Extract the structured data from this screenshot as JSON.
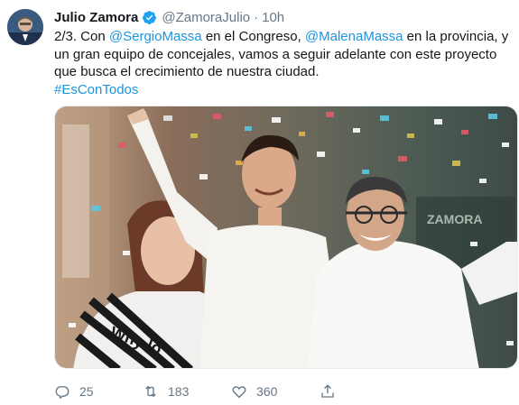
{
  "tweet": {
    "author_name": "Julio Zamora",
    "author_handle": "@ZamoraJulio",
    "separator": "·",
    "time": "10h",
    "text": {
      "part1": "2/3. Con ",
      "mention1": "@SergioMassa",
      "part2": " en el Congreso,  ",
      "mention2": "@MalenaMassa",
      "part3": " en la provincia, y un gran equipo de concejales, vamos a seguir adelante con este proyecto que busca el crecimiento de nuestra ciudad.",
      "hashtag": "#EsConTodos"
    },
    "media": {
      "shirt_text": "Why lo",
      "banner_text": "ZAMORA"
    },
    "actions": {
      "replies": "25",
      "retweets": "183",
      "likes": "360"
    }
  },
  "colors": {
    "link": "#1b95e0",
    "secondary_text": "#657786",
    "verified": "#1da1f2"
  },
  "icons": [
    "verified-icon",
    "reply-icon",
    "retweet-icon",
    "like-icon",
    "share-icon"
  ]
}
